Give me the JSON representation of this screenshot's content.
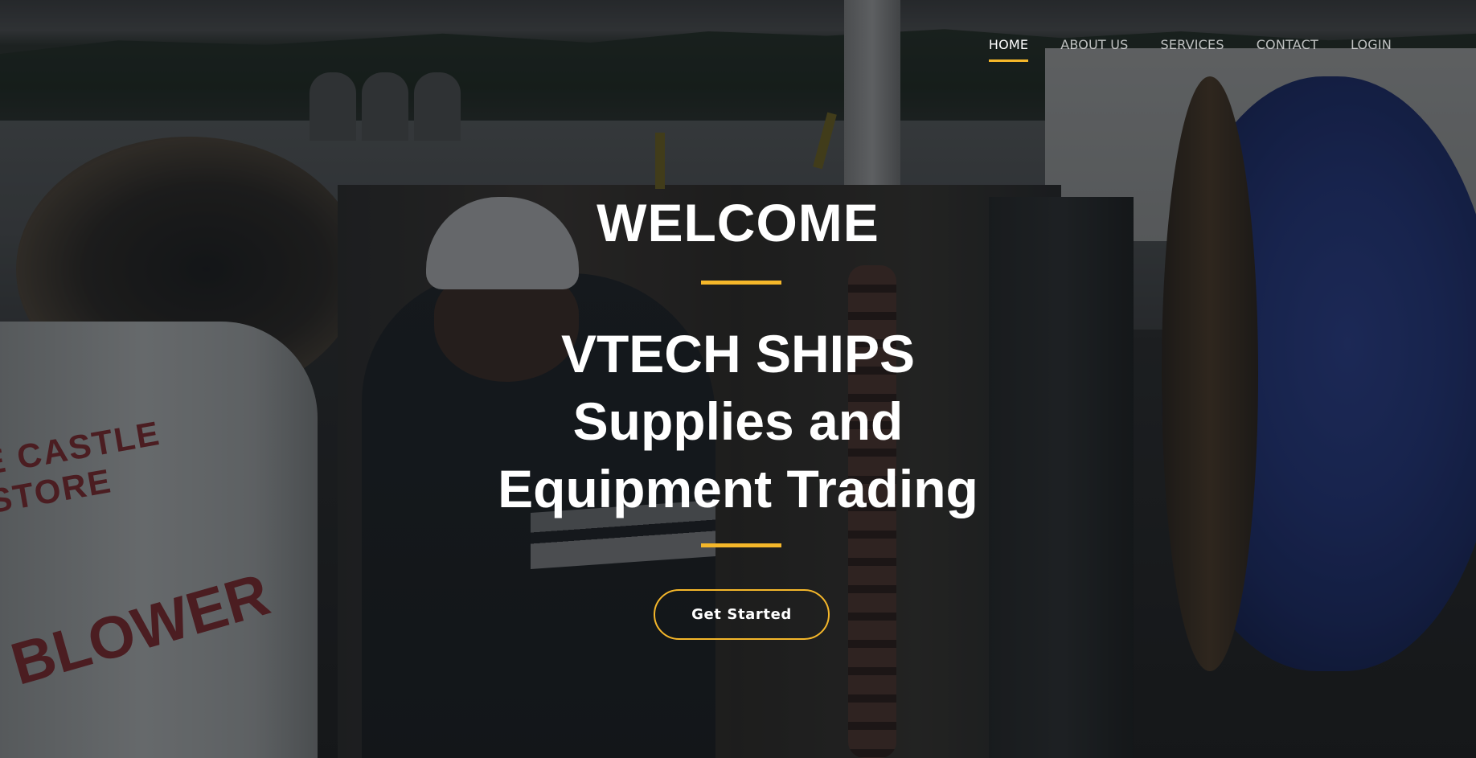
{
  "nav": {
    "items": [
      {
        "label": "HOME",
        "active": true
      },
      {
        "label": "ABOUT US",
        "active": false
      },
      {
        "label": "SERVICES",
        "active": false
      },
      {
        "label": "CONTACT",
        "active": false
      },
      {
        "label": "LOGIN",
        "active": false
      }
    ]
  },
  "hero": {
    "welcome": "WELCOME",
    "title_lines": [
      "VTECH SHIPS",
      "Supplies and",
      "Equipment Trading"
    ],
    "cta_label": "Get Started",
    "background_text": {
      "line1": "E CASTLE STORE",
      "line2": "BLOWER"
    }
  },
  "colors": {
    "accent": "#f5b72a",
    "text": "#ffffff",
    "overlay": "rgba(10,12,14,0.42)"
  }
}
